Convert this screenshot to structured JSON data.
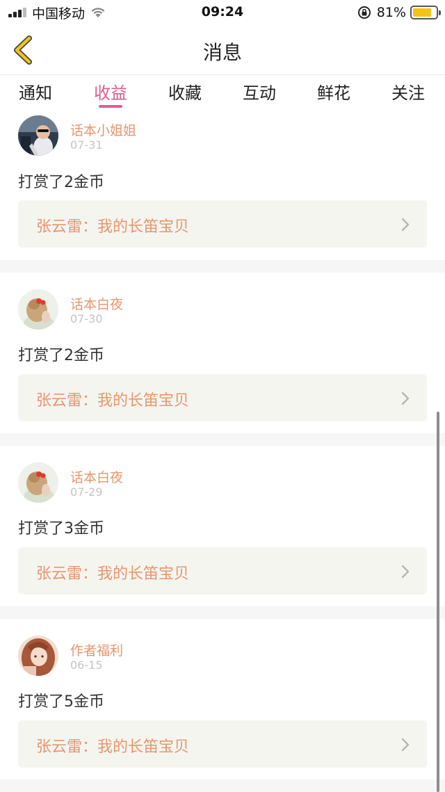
{
  "status_bar": {
    "carrier": "中国移动",
    "time": "09:24",
    "battery_percent": "81%",
    "battery_level": 0.81,
    "signal_icon": "signal-bars-icon",
    "wifi_icon": "wifi-icon",
    "rotation_lock_icon": "rotation-lock-icon"
  },
  "nav": {
    "title": "消息",
    "back_icon": "back-chevron-icon"
  },
  "tabs": [
    {
      "label": "通知"
    },
    {
      "label": "收益",
      "active": true
    },
    {
      "label": "收藏"
    },
    {
      "label": "互动"
    },
    {
      "label": "鲜花"
    },
    {
      "label": "关注"
    }
  ],
  "messages": [
    {
      "user": "话本小姐姐",
      "date": "07-31",
      "text": "打赏了2金币",
      "ref": "张云雷：我的长笛宝贝"
    },
    {
      "user": "话本白夜",
      "date": "07-30",
      "text": "打赏了2金币",
      "ref": "张云雷：我的长笛宝贝"
    },
    {
      "user": "话本白夜",
      "date": "07-29",
      "text": "打赏了3金币",
      "ref": "张云雷：我的长笛宝贝"
    },
    {
      "user": "作者福利",
      "date": "06-15",
      "text": "打赏了5金币",
      "ref": "张云雷：我的长笛宝贝"
    }
  ],
  "colors": {
    "accent_pink": "#e05d8f",
    "name_orange": "#e8956b",
    "back_yellow": "#f0c419",
    "ref_bg": "#f5f5f0"
  }
}
